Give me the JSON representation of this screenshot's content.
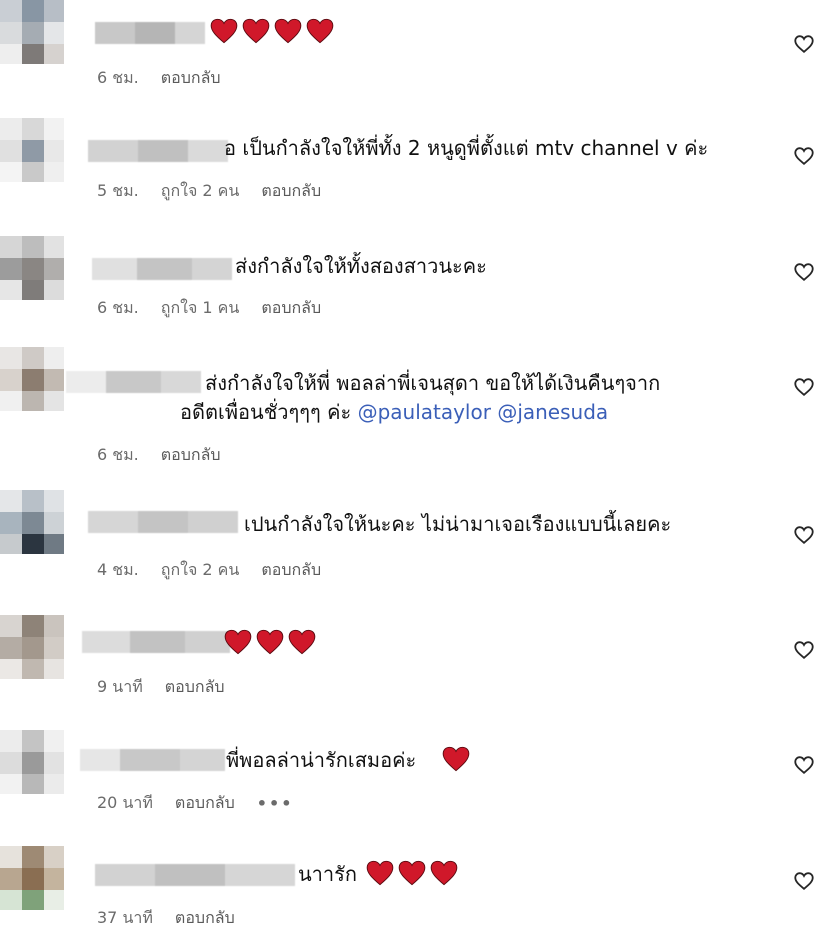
{
  "comments": [
    {
      "text": "",
      "hearts": 4,
      "time": "6 ชม.",
      "likes": "",
      "reply": "ตอบกลับ"
    },
    {
      "text": "อ เป็นกำลังใจให้พี่ทั้ง 2 หนูดูพี่ตั้งแต่ mtv channel v ค่ะ",
      "hearts": 0,
      "time": "5 ชม.",
      "likes": "ถูกใจ 2 คน",
      "reply": "ตอบกลับ"
    },
    {
      "text": "ส่งกำลังใจให้ทั้งสองสาวนะคะ",
      "hearts": 0,
      "time": "6 ชม.",
      "likes": "ถูกใจ 1 คน",
      "reply": "ตอบกลับ"
    },
    {
      "text": "ส่งกำลังใจให้พี่ พอลล่าพี่เจนสุดา ขอให้ได้เงินคืนๆจาก",
      "text2": "อดีตเพื่อนชั่วๆๆๆ ค่ะ",
      "mention1": "@paulataylor",
      "mention2": "@janesuda",
      "hearts": 0,
      "time": "6 ชม.",
      "likes": "",
      "reply": "ตอบกลับ"
    },
    {
      "text": "เปนกำลังใจให้นะคะ ไม่น่ามาเจอเรืองแบบนี้เลยคะ",
      "hearts": 0,
      "time": "4 ชม.",
      "likes": "ถูกใจ 2 คน",
      "reply": "ตอบกลับ"
    },
    {
      "text": "",
      "hearts": 3,
      "time": "9 นาที",
      "likes": "",
      "reply": "ตอบกลับ"
    },
    {
      "text": "พี่พอลล่าน่ารักเสมอค่ะ",
      "hearts": 1,
      "time": "20 นาที",
      "likes": "",
      "reply": "ตอบกลับ",
      "more": "•••"
    },
    {
      "text": "นาารัก",
      "hearts": 3,
      "time": "37 นาที",
      "likes": "",
      "reply": "ตอบกลับ"
    }
  ],
  "colors": {
    "heart": "#d0182a",
    "meta": "#6b6b6b",
    "mention": "#3b5fb8"
  },
  "icons": {
    "like": "heart-outline-icon",
    "reaction": "red-heart-icon"
  }
}
